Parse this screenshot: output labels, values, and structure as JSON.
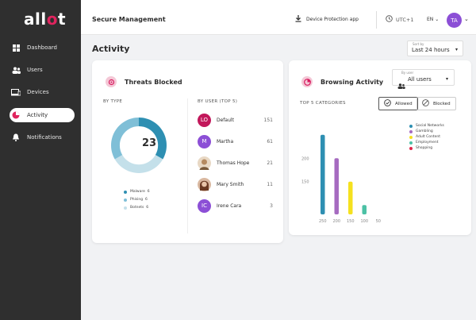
{
  "brand": {
    "logo_main": "all",
    "logo_accent": "o",
    "logo_end": "t"
  },
  "sidebar": {
    "items": [
      {
        "label": "Dashboard",
        "icon": "dashboard-icon"
      },
      {
        "label": "Users",
        "icon": "users-icon"
      },
      {
        "label": "Devices",
        "icon": "devices-icon"
      },
      {
        "label": "Activity",
        "icon": "activity-icon",
        "active": true
      },
      {
        "label": "Notifications",
        "icon": "bell-icon"
      }
    ]
  },
  "topbar": {
    "title": "Secure Management",
    "device_protection": "Device Protection app",
    "utc": "UTC+1",
    "lang": "EN",
    "avatar": "TA"
  },
  "page": {
    "title": "Activity",
    "sort_label": "Sort by",
    "sort_value": "Last 24 hours"
  },
  "threats": {
    "title": "Threats Blocked",
    "by_type_label": "BY TYPE",
    "by_user_label": "BY USER (TOP 5)",
    "total": "23",
    "types": [
      {
        "label": "Malware",
        "count": "6",
        "color": "#2e8fb2"
      },
      {
        "label": "Phising",
        "count": "6",
        "color": "#7fbfd7"
      },
      {
        "label": "Botnets",
        "count": "6",
        "color": "#c4e0ea"
      }
    ],
    "users": [
      {
        "initials": "LO",
        "name": "Default",
        "count": "151",
        "color": "#c2185b"
      },
      {
        "initials": "M",
        "name": "Martha",
        "count": "61",
        "color": "#8c4fd6"
      },
      {
        "initials": "",
        "name": "Thomas Hope",
        "count": "21",
        "color": "#b58a60"
      },
      {
        "initials": "",
        "name": "Mary Smith",
        "count": "11",
        "color": "#a0522d"
      },
      {
        "initials": "IC",
        "name": "Irene Cara",
        "count": "3",
        "color": "#8c4fd6"
      }
    ]
  },
  "browsing": {
    "title": "Browsing Activity",
    "by_user_label": "By user",
    "by_user_value": "All users",
    "top_label": "TOP 5 CATEGORIES",
    "allowed_label": "Allowed",
    "blocked_label": "Blocked"
  },
  "chart_data": {
    "type": "bar",
    "categories": [
      "Social Networks",
      "Gambling",
      "Adult Content",
      "Employment",
      "Shopping"
    ],
    "x_tick_labels": [
      "250",
      "200",
      "150",
      "100",
      "50"
    ],
    "values": [
      250,
      200,
      150,
      100,
      50
    ],
    "colors": [
      "#2e8fb2",
      "#a66bc0",
      "#f5e11f",
      "#4cc1a5",
      "#e0264a"
    ],
    "y_ticks": [
      "200",
      "150"
    ],
    "ylim": [
      80,
      270
    ],
    "legend": "right"
  }
}
